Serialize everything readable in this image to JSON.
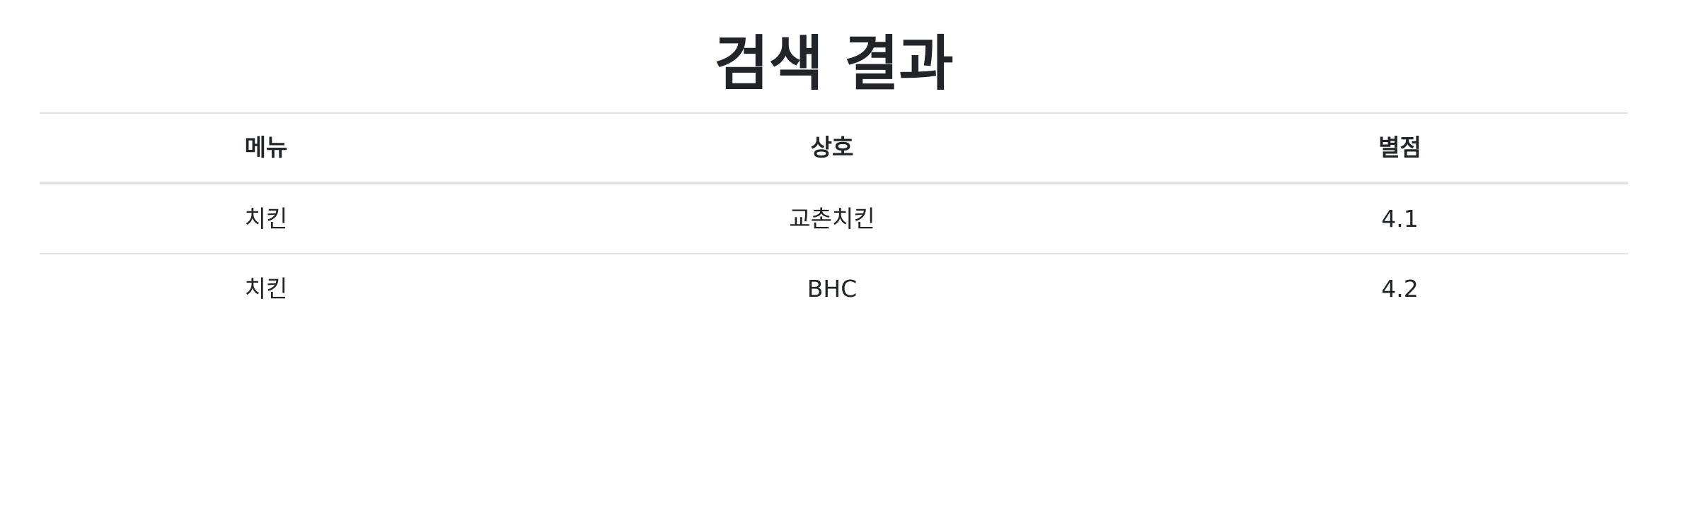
{
  "page": {
    "title": "검색 결과"
  },
  "table": {
    "headers": [
      "메뉴",
      "상호",
      "별점"
    ],
    "rows": [
      [
        "치킨",
        "교촌치킨",
        "4.1"
      ],
      [
        "치킨",
        "BHC",
        "4.2"
      ]
    ]
  },
  "colors": {
    "text": "#212529",
    "border": "#dee2e6",
    "background": "#ffffff"
  }
}
